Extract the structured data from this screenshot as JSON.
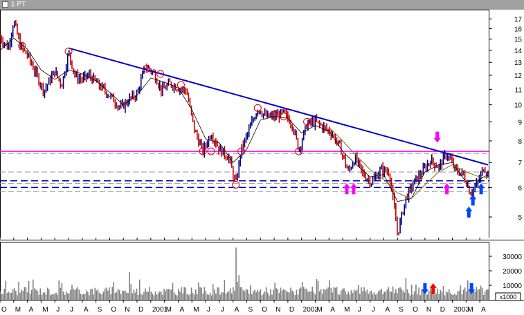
{
  "window": {
    "title": "1 PT"
  },
  "colors": {
    "up_bar": "#000080",
    "down_bar": "#c00000",
    "ma_fast": "#000000",
    "ma_slow": "#8b6914",
    "trendline": "#0000cc",
    "horizontal_line": "#ff00ff",
    "support_dashes": "#0000aa",
    "volume": "#808080",
    "arrow_magenta": "#ff00ff",
    "arrow_blue": "#0044ff",
    "arrow_red": "#ff0000",
    "circle_marker": "#e00000"
  },
  "chart_data": [
    {
      "type": "line",
      "name": "price",
      "y_scale": "log",
      "ylim": [
        4.4,
        18
      ],
      "y_ticks": [
        5,
        6,
        7,
        8,
        9,
        10,
        11,
        12,
        13,
        14,
        15,
        16,
        17
      ],
      "x_tick_labels": [
        "O",
        "M",
        "A",
        "M",
        "J",
        "J",
        "A",
        "S",
        "O",
        "N",
        "D",
        "2001",
        "M",
        "A",
        "M",
        "J",
        "J",
        "A",
        "S",
        "O",
        "N",
        "D",
        "2002",
        "M",
        "A",
        "M",
        "J",
        "J",
        "A",
        "S",
        "O",
        "N",
        "D",
        "2003",
        "M",
        "A"
      ],
      "x_range_months": [
        "1999-10",
        "2003-04"
      ],
      "price_path": [
        [
          0,
          15.2
        ],
        [
          0.6,
          14.2
        ],
        [
          1.0,
          16.8
        ],
        [
          1.5,
          14.3
        ],
        [
          2.0,
          13.6
        ],
        [
          2.5,
          12.4
        ],
        [
          3.2,
          10.9
        ],
        [
          4.0,
          12.3
        ],
        [
          4.5,
          11.3
        ],
        [
          5.0,
          13.8
        ],
        [
          5.5,
          11.9
        ],
        [
          6.0,
          11.7
        ],
        [
          6.5,
          12.0
        ],
        [
          7.2,
          11.3
        ],
        [
          8.0,
          10.6
        ],
        [
          8.8,
          9.8
        ],
        [
          9.5,
          10.4
        ],
        [
          10.0,
          10.7
        ],
        [
          10.6,
          12.7
        ],
        [
          11.2,
          12.2
        ],
        [
          11.8,
          10.9
        ],
        [
          12.4,
          11.4
        ],
        [
          13.0,
          11.1
        ],
        [
          13.6,
          10.9
        ],
        [
          14.2,
          8.5
        ],
        [
          14.8,
          7.5
        ],
        [
          15.4,
          8.4
        ],
        [
          16.0,
          7.6
        ],
        [
          16.7,
          7.2
        ],
        [
          17.2,
          6.1
        ],
        [
          17.6,
          7.6
        ],
        [
          18.2,
          8.6
        ],
        [
          18.8,
          9.8
        ],
        [
          19.4,
          9.3
        ],
        [
          20.0,
          9.3
        ],
        [
          20.7,
          9.5
        ],
        [
          21.3,
          8.9
        ],
        [
          21.8,
          7.6
        ],
        [
          22.4,
          8.9
        ],
        [
          23.0,
          9.0
        ],
        [
          23.6,
          8.7
        ],
        [
          24.2,
          8.4
        ],
        [
          24.8,
          7.7
        ],
        [
          25.4,
          6.6
        ],
        [
          25.9,
          7.2
        ],
        [
          26.5,
          6.5
        ],
        [
          27.1,
          6.2
        ],
        [
          27.8,
          6.7
        ],
        [
          28.4,
          6.6
        ],
        [
          29.0,
          4.5
        ],
        [
          29.6,
          5.6
        ],
        [
          30.2,
          6.2
        ],
        [
          30.8,
          6.6
        ],
        [
          31.4,
          7.1
        ],
        [
          32.0,
          6.8
        ],
        [
          32.6,
          7.4
        ],
        [
          33.2,
          6.7
        ],
        [
          33.8,
          6.5
        ],
        [
          34.3,
          5.8
        ],
        [
          34.8,
          6.1
        ],
        [
          35.3,
          6.8
        ],
        [
          35.6,
          6.5
        ]
      ],
      "indicators": {
        "moving_average_fast": [
          [
            0,
            14.0
          ],
          [
            1.0,
            15.1
          ],
          [
            2.0,
            14.1
          ],
          [
            3.0,
            12.4
          ],
          [
            4.0,
            11.7
          ],
          [
            5.0,
            12.4
          ],
          [
            6.0,
            12.1
          ],
          [
            7.0,
            11.6
          ],
          [
            8.0,
            10.8
          ],
          [
            9.0,
            10.0
          ],
          [
            10.0,
            10.6
          ],
          [
            11.0,
            11.8
          ],
          [
            12.0,
            11.5
          ],
          [
            13.0,
            11.1
          ],
          [
            14.0,
            9.7
          ],
          [
            15.0,
            8.1
          ],
          [
            16.0,
            7.9
          ],
          [
            17.0,
            7.0
          ],
          [
            18.0,
            7.6
          ],
          [
            19.0,
            9.1
          ],
          [
            20.0,
            9.3
          ],
          [
            21.0,
            9.2
          ],
          [
            22.0,
            8.4
          ],
          [
            23.0,
            8.8
          ],
          [
            24.0,
            8.5
          ],
          [
            25.0,
            7.5
          ],
          [
            26.0,
            6.9
          ],
          [
            27.0,
            6.4
          ],
          [
            28.0,
            6.5
          ],
          [
            29.0,
            5.5
          ],
          [
            30.0,
            5.6
          ],
          [
            31.0,
            6.6
          ],
          [
            32.0,
            6.9
          ],
          [
            33.0,
            7.0
          ],
          [
            34.0,
            6.2
          ],
          [
            35.0,
            6.3
          ],
          [
            35.6,
            6.5
          ]
        ],
        "moving_average_slow": [
          [
            24.0,
            8.7
          ],
          [
            25.0,
            8.0
          ],
          [
            26.0,
            7.3
          ],
          [
            27.0,
            6.7
          ],
          [
            28.0,
            6.3
          ],
          [
            29.0,
            5.8
          ],
          [
            30.0,
            5.6
          ],
          [
            31.0,
            6.1
          ],
          [
            32.0,
            6.6
          ],
          [
            33.0,
            6.9
          ],
          [
            34.0,
            6.6
          ],
          [
            35.0,
            6.4
          ],
          [
            35.6,
            6.4
          ]
        ],
        "trendline": [
          [
            5.0,
            14.2
          ],
          [
            35.6,
            6.9
          ]
        ],
        "horizontal_lines": [
          7.5
        ],
        "support_levels_dashed": [
          7.4,
          6.6,
          6.25,
          6.15,
          6.0,
          5.85
        ],
        "circle_markers": [
          [
            1.6,
            14.4
          ],
          [
            5.0,
            13.9
          ],
          [
            10.7,
            12.5
          ],
          [
            11.7,
            12.1
          ],
          [
            13.2,
            11.3
          ],
          [
            14.8,
            7.5
          ],
          [
            15.4,
            7.5
          ],
          [
            17.2,
            6.1
          ],
          [
            17.6,
            7.5
          ],
          [
            18.8,
            9.8
          ],
          [
            20.0,
            9.4
          ],
          [
            20.7,
            9.3
          ],
          [
            21.8,
            7.5
          ],
          [
            22.4,
            9.0
          ]
        ],
        "arrows": [
          {
            "x": 25.3,
            "y": 6.0,
            "dir": "up",
            "color": "magenta"
          },
          {
            "x": 25.8,
            "y": 6.0,
            "dir": "up",
            "color": "magenta"
          },
          {
            "x": 31.9,
            "y": 7.2,
            "dir": "down",
            "color": "magenta"
          },
          {
            "x": 32.6,
            "y": 6.0,
            "dir": "up",
            "color": "magenta"
          },
          {
            "x": 34.2,
            "y": 5.2,
            "dir": "up",
            "color": "blue"
          },
          {
            "x": 34.5,
            "y": 5.6,
            "dir": "up",
            "color": "blue"
          },
          {
            "x": 35.1,
            "y": 6.0,
            "dir": "up",
            "color": "blue"
          }
        ]
      }
    },
    {
      "type": "bar",
      "name": "volume",
      "unit_label": "x1000",
      "ylim": [
        0,
        40000
      ],
      "y_ticks": [
        10000,
        20000,
        30000
      ],
      "y_tick_labels": [
        "10000",
        "20000",
        "30000"
      ],
      "spikes": [
        {
          "month": 17.2,
          "value": 36000
        },
        {
          "month": 17.4,
          "value": 17000
        },
        {
          "month": 9.4,
          "value": 19000
        },
        {
          "month": 10.2,
          "value": 14000
        },
        {
          "month": 2.4,
          "value": 14000
        },
        {
          "month": 29.6,
          "value": 15000
        },
        {
          "month": 14.5,
          "value": 12000
        }
      ],
      "baseline_range": [
        3000,
        9000
      ],
      "arrows": [
        {
          "x": 31.0,
          "dir": "down",
          "color": "blue"
        },
        {
          "x": 31.6,
          "dir": "up",
          "color": "red"
        },
        {
          "x": 34.4,
          "dir": "down",
          "color": "blue"
        }
      ]
    }
  ]
}
